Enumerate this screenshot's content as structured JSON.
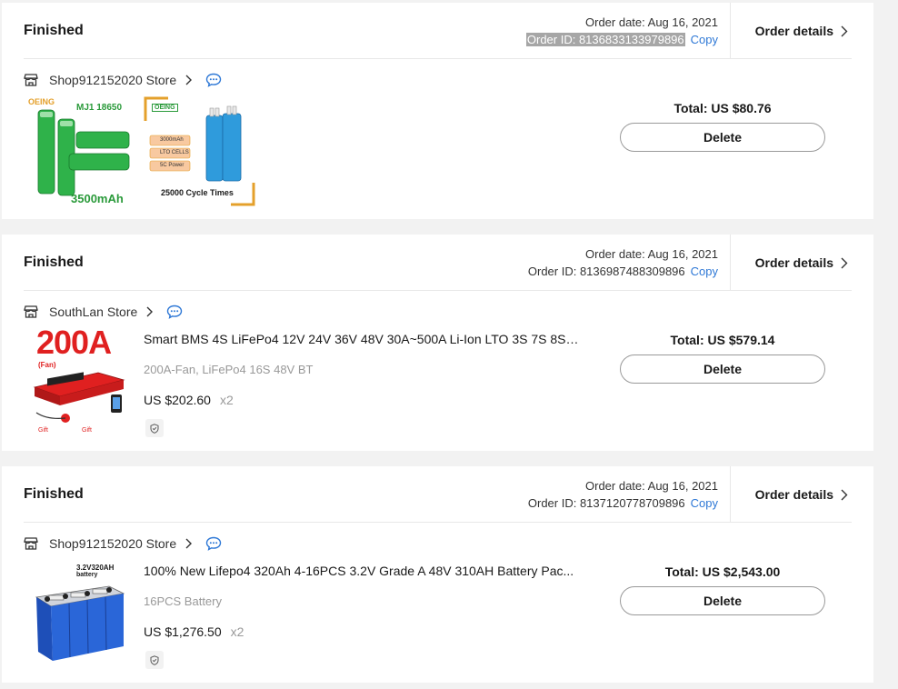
{
  "orders": [
    {
      "status": "Finished",
      "date_label": "Order date: Aug 16, 2021",
      "id_prefix": "Order ID: ",
      "id_value": "8136833133979896",
      "copy_label": "Copy",
      "details_label": "Order details",
      "store": "Shop912152020 Store",
      "total": "Total: US $80.76",
      "delete_label": "Delete",
      "image_text": {
        "brand": "OEING",
        "model": "MJ1 18650",
        "capacity": "3500mAh",
        "badge": "OEING",
        "spec1": "3000mAh",
        "spec2": "LTO CELLS",
        "spec3": "5C Power",
        "cycles": "25000 Cycle Times"
      }
    },
    {
      "status": "Finished",
      "date_label": "Order date: Aug 16, 2021",
      "id_label": "Order ID: 8136987488309896",
      "copy_label": "Copy",
      "details_label": "Order details",
      "store": "SouthLan Store",
      "title": "Smart BMS 4S LiFePo4 12V 24V 36V 48V 30A~500A Li-Ion LTO 3S 7S 8S ...",
      "variant": "200A-Fan, LiFePo4 16S 48V BT",
      "price": "US $202.60",
      "qty": "x2",
      "total": "Total: US $579.14",
      "delete_label": "Delete",
      "image_text": {
        "big": "200A",
        "sub": "(Fan)",
        "gift1": "Gift",
        "gift2": "Gift"
      }
    },
    {
      "status": "Finished",
      "date_label": "Order date: Aug 16, 2021",
      "id_label": "Order ID: 8137120778709896",
      "copy_label": "Copy",
      "details_label": "Order details",
      "store": "Shop912152020 Store",
      "title": "100% New Lifepo4 320Ah 4-16PCS 3.2V Grade A 48V 310AH Battery Pac...",
      "variant": "16PCS Battery",
      "price": "US $1,276.50",
      "qty": "x2",
      "total": "Total: US $2,543.00",
      "delete_label": "Delete",
      "image_text": {
        "label1": "3.2V320AH",
        "label2": "battery"
      }
    }
  ],
  "colors": {
    "link": "#2e78d6",
    "highlight": "#a6a6a6",
    "battery_green": "#2fb24a",
    "battery_blue": "#2f9bdc",
    "bms_red": "#e02020"
  }
}
